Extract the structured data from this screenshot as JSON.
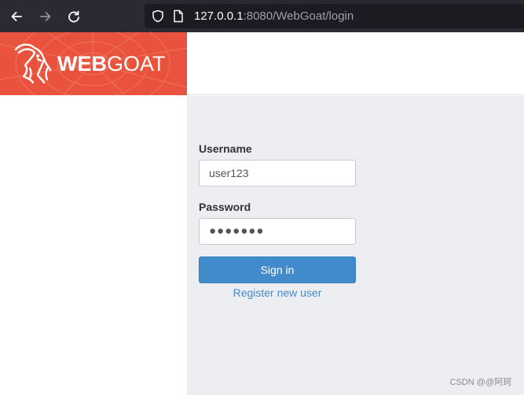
{
  "browser": {
    "url_host": "127.0.0.1",
    "url_rest": ":8080/WebGoat/login"
  },
  "header": {
    "brand_bold": "WEB",
    "brand_light": "GOAT",
    "brand_color": "#e9533d"
  },
  "login": {
    "username_label": "Username",
    "username_value": "user123",
    "password_label": "Password",
    "password_value": "●●●●●●●",
    "signin_label": "Sign in",
    "register_link": "Register new user",
    "button_color": "#428bca"
  },
  "watermark": "CSDN @@阿珂",
  "icons": [
    "back-arrow-icon",
    "forward-arrow-icon",
    "reload-icon",
    "shield-icon",
    "page-icon",
    "goat-logo-icon"
  ]
}
